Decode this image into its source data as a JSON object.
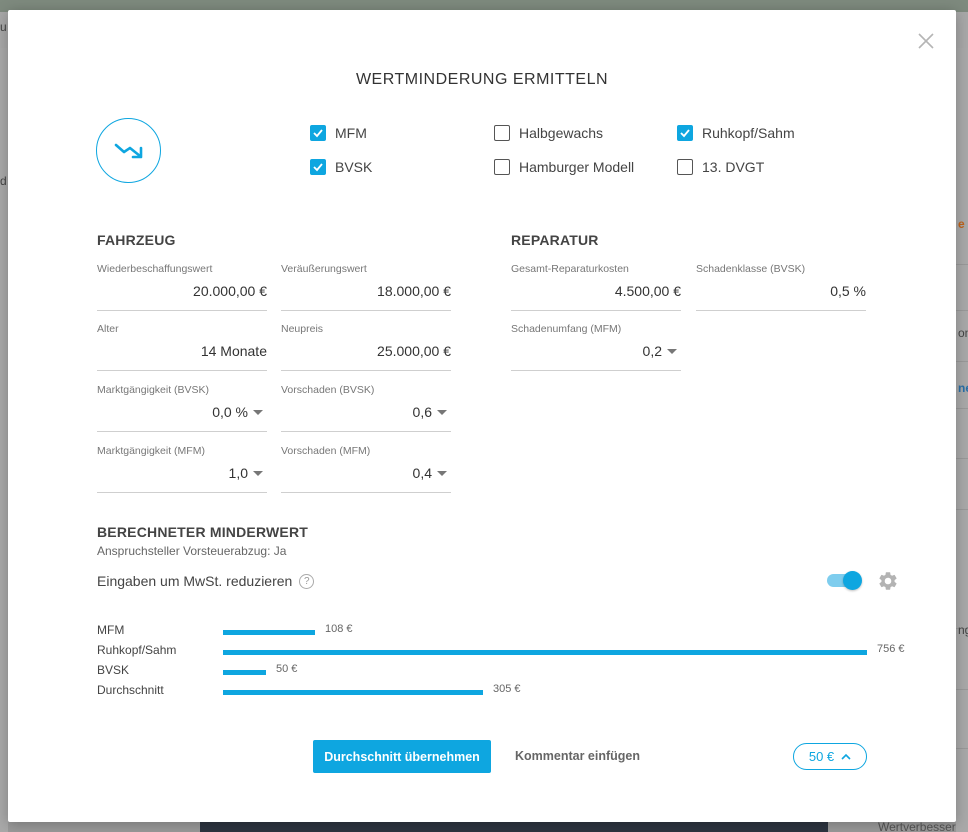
{
  "background": {
    "fragments": [
      "u",
      "d",
      "e",
      "on",
      "ne",
      "ng",
      "Wertverbesser"
    ]
  },
  "modal": {
    "title": "WERTMINDERUNG ERMITTELN",
    "icons": {
      "close": "close-icon",
      "trend": "trend-down-icon"
    },
    "methods": [
      {
        "label": "MFM",
        "checked": true
      },
      {
        "label": "BVSK",
        "checked": true
      },
      {
        "label": "Halbgewachs",
        "checked": false
      },
      {
        "label": "Hamburger Modell",
        "checked": false
      },
      {
        "label": "Ruhkopf/Sahm",
        "checked": true
      },
      {
        "label": "13. DVGT",
        "checked": false
      }
    ],
    "fahrzeug": {
      "heading": "FAHRZEUG",
      "wiederbeschaffungswert": {
        "label": "Wiederbeschaffungswert",
        "value": "20.000,00 €"
      },
      "veraeusserungswert": {
        "label": "Veräußerungswert",
        "value": "18.000,00 €"
      },
      "alter": {
        "label": "Alter",
        "value": "14 Monate"
      },
      "neupreis": {
        "label": "Neupreis",
        "value": "25.000,00 €"
      },
      "marktgaengigkeit_bvsk": {
        "label": "Marktgängigkeit (BVSK)",
        "value": "0,0 %"
      },
      "vorschaden_bvsk": {
        "label": "Vorschaden (BVSK)",
        "value": "0,6"
      },
      "marktgaengigkeit_mfm": {
        "label": "Marktgängigkeit (MFM)",
        "value": "1,0"
      },
      "vorschaden_mfm": {
        "label": "Vorschaden (MFM)",
        "value": "0,4"
      }
    },
    "reparatur": {
      "heading": "REPARATUR",
      "gesamt": {
        "label": "Gesamt-Reparaturkosten",
        "value": "4.500,00 €"
      },
      "schadenklasse": {
        "label": "Schadenklasse (BVSK)",
        "value": "0,5 %"
      },
      "schadenumfang": {
        "label": "Schadenumfang (MFM)",
        "value": "0,2"
      }
    },
    "result": {
      "heading": "BERECHNETER MINDERWERT",
      "vorsteuer": "Anspruchsteller Vorsteuerabzug: Ja",
      "mwst_label": "Eingaben um MwSt. reduzieren",
      "help": "?",
      "mwst_toggle_on": true,
      "accent_color": "#0ea6e0",
      "bars": [
        {
          "label": "MFM",
          "value": 108,
          "display": "108 €"
        },
        {
          "label": "Ruhkopf/Sahm",
          "value": 756,
          "display": "756 €"
        },
        {
          "label": "BVSK",
          "value": 50,
          "display": "50 €"
        },
        {
          "label": "Durchschnitt",
          "value": 305,
          "display": "305 €"
        }
      ]
    },
    "footer": {
      "primary": "Durchschnitt übernehmen",
      "comment": "Kommentar einfügen",
      "amount": "50 €"
    }
  }
}
